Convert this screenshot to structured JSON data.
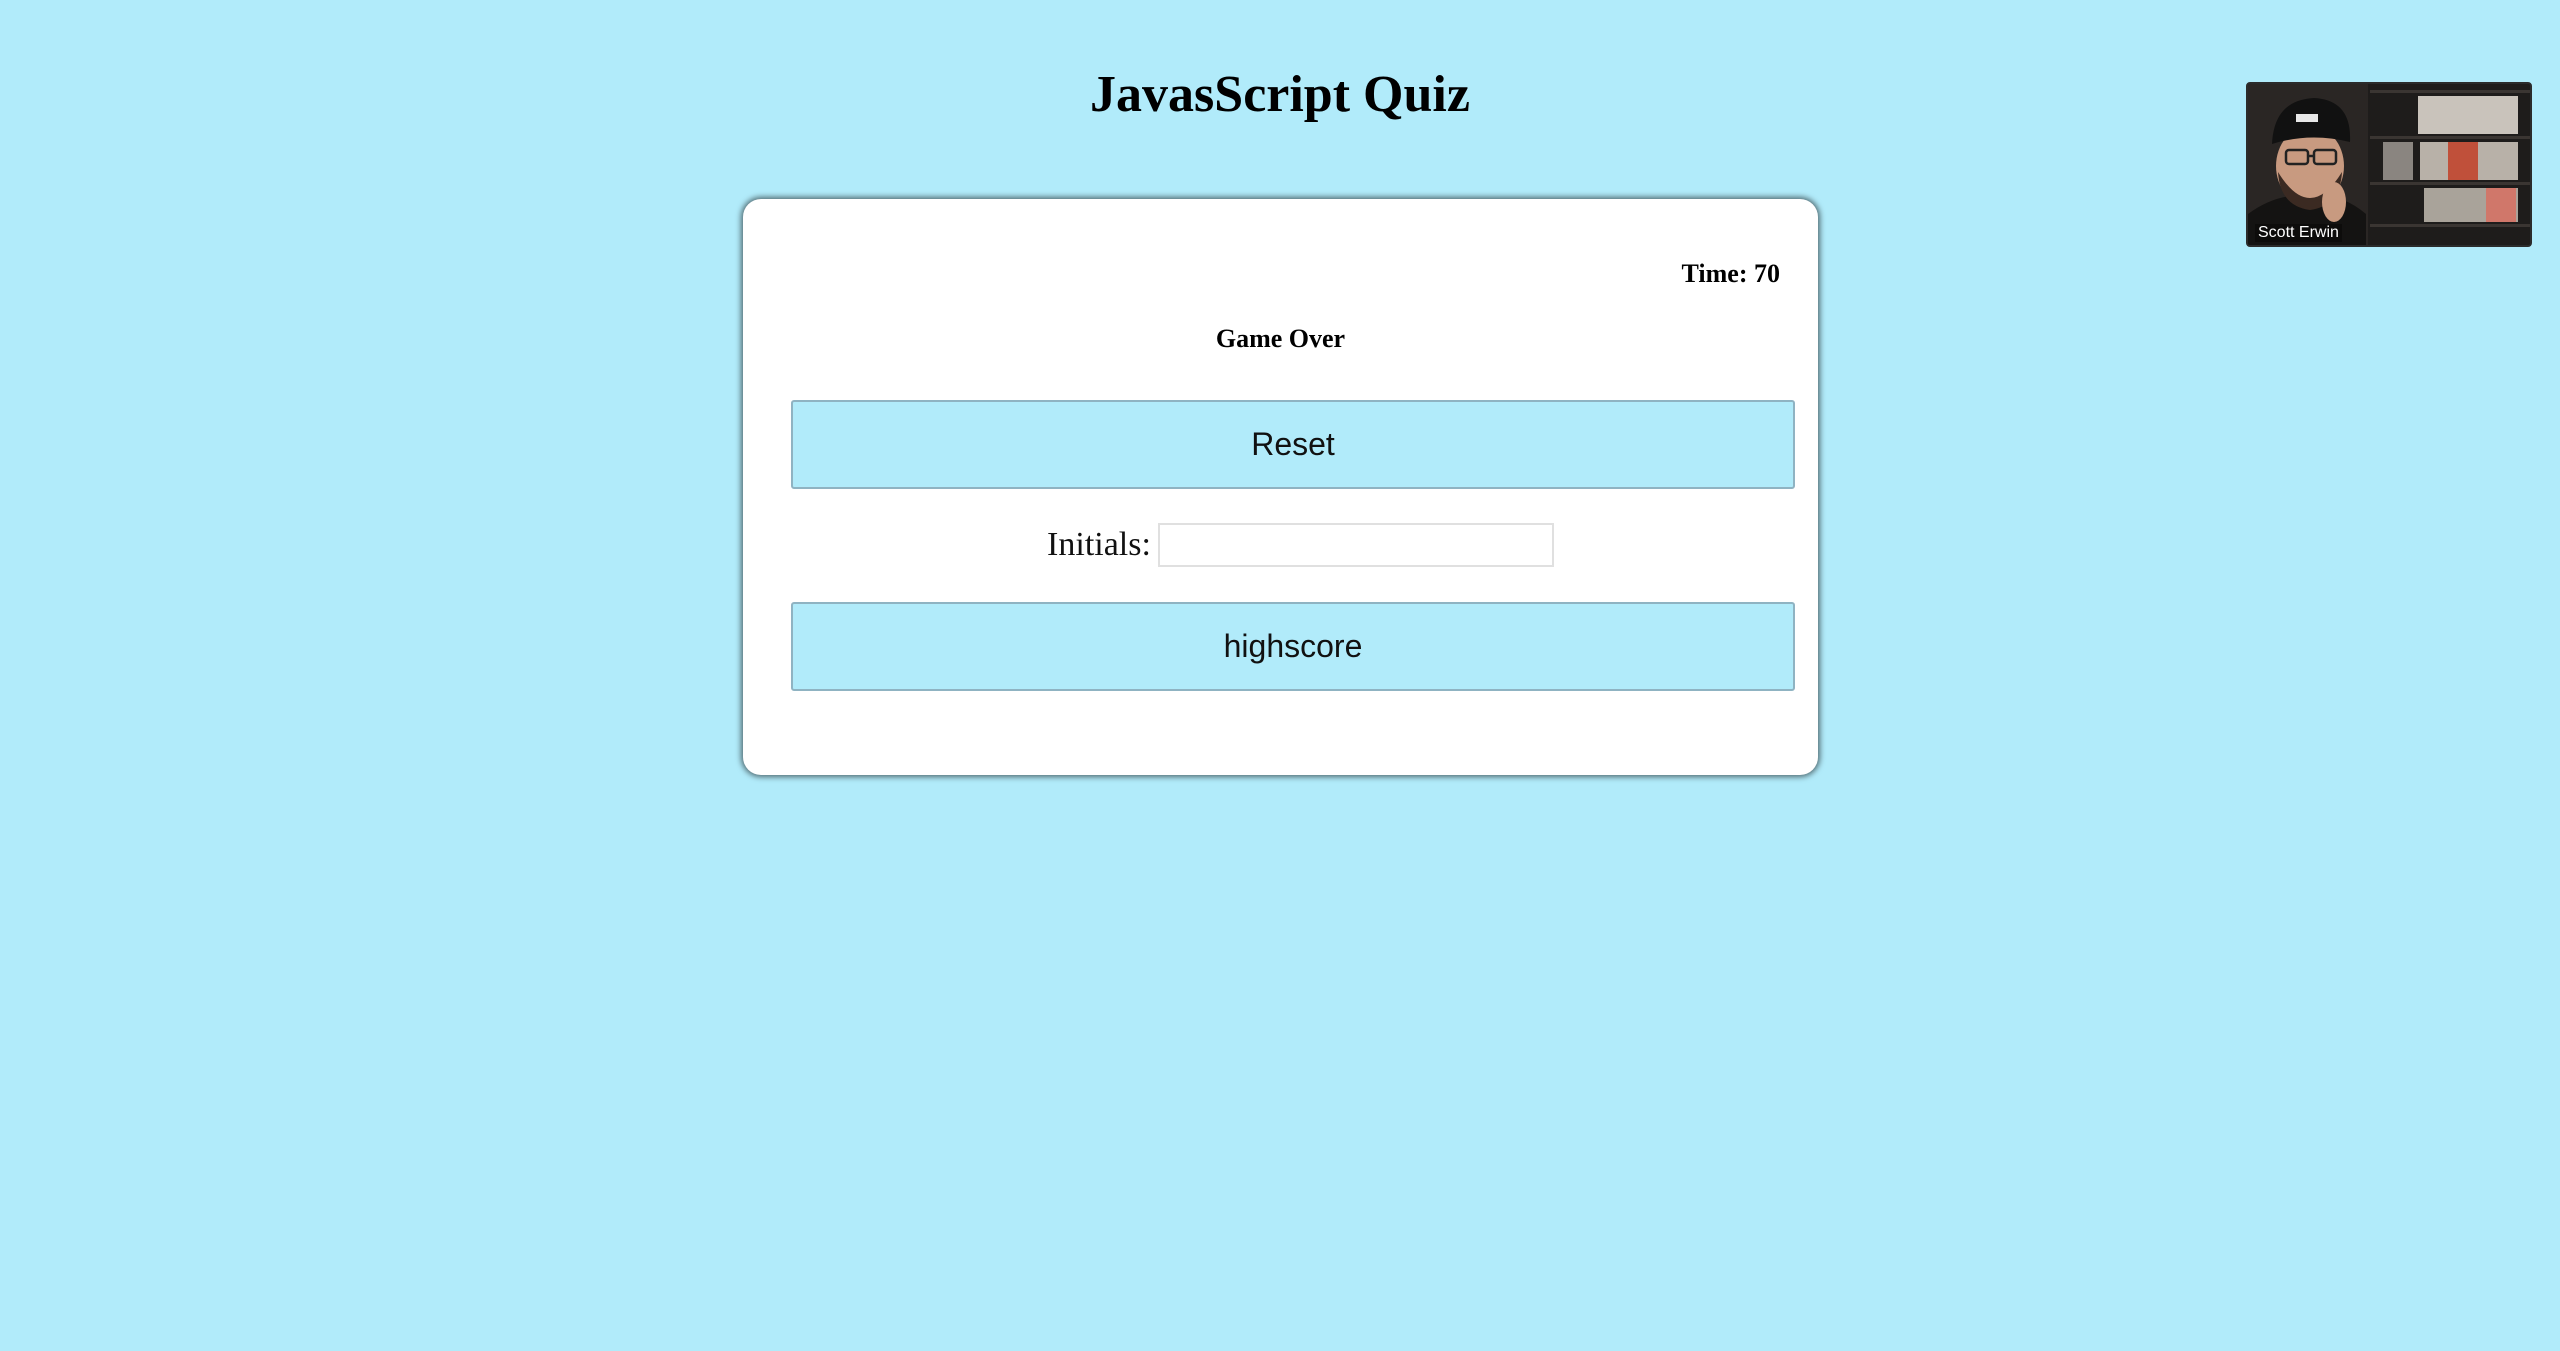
{
  "page": {
    "title": "JavasScript Quiz"
  },
  "quiz": {
    "timer_text": "Time: 70",
    "status_text": "Game Over",
    "reset_label": "Reset",
    "initials_label": "Initials:",
    "initials_value": "",
    "highscore_label": "highscore"
  },
  "video_call": {
    "participant_name": "Scott Erwin"
  },
  "colors": {
    "background": "#b1ebfa",
    "card": "#ffffff",
    "button": "#b1ebfa"
  }
}
